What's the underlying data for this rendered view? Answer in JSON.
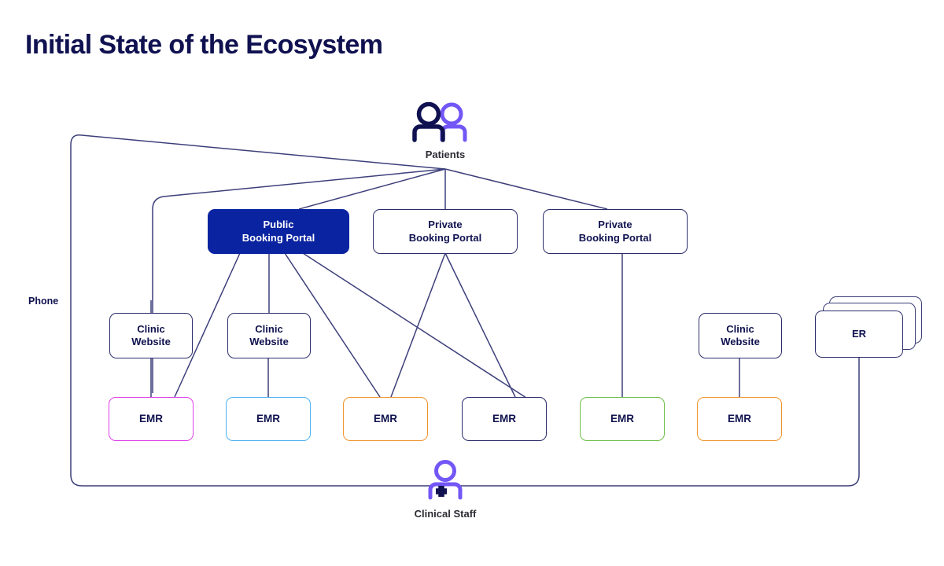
{
  "page": {
    "title": "Initial State of the Ecosystem",
    "background": "#ffffff",
    "title_color": "#0f1150"
  },
  "colors": {
    "navy": "#2b2d6b",
    "deep_navy": "#10124f",
    "portal_fill": "#0a23a0",
    "wire": "#3c3f7a",
    "emr_pink": "#e040e8",
    "emr_blue": "#4fb3f0",
    "emr_orange": "#f0952e",
    "emr_navy": "#2b2d6b",
    "emr_green": "#6fbf4a",
    "persona_purple": "#7357f6",
    "persona_navy": "#0f1150"
  },
  "personas": {
    "patients": {
      "label": "Patients",
      "icon": "two-people-icon"
    },
    "clinical_staff": {
      "label": "Clinical Staff",
      "icon": "person-with-plus-icon"
    }
  },
  "labels": {
    "phone": "Phone"
  },
  "portals": [
    {
      "line1": "Public",
      "line2": "Booking Portal",
      "style": "filled"
    },
    {
      "line1": "Private",
      "line2": "Booking Portal",
      "style": "outline"
    },
    {
      "line1": "Private",
      "line2": "Booking Portal",
      "style": "outline"
    }
  ],
  "clinic_websites": [
    {
      "line1": "Clinic",
      "line2": "Website"
    },
    {
      "line1": "Clinic",
      "line2": "Website"
    },
    {
      "line1": "Clinic",
      "line2": "Website"
    }
  ],
  "emrs": [
    {
      "label": "EMR",
      "accent": "#e040e8"
    },
    {
      "label": "EMR",
      "accent": "#4fb3f0"
    },
    {
      "label": "EMR",
      "accent": "#f0952e"
    },
    {
      "label": "EMR",
      "accent": "#2b2d6b"
    },
    {
      "label": "EMR",
      "accent": "#6fbf4a"
    },
    {
      "label": "EMR",
      "accent": "#f0952e"
    }
  ],
  "er": {
    "label": "ER",
    "stack_count": 3
  }
}
